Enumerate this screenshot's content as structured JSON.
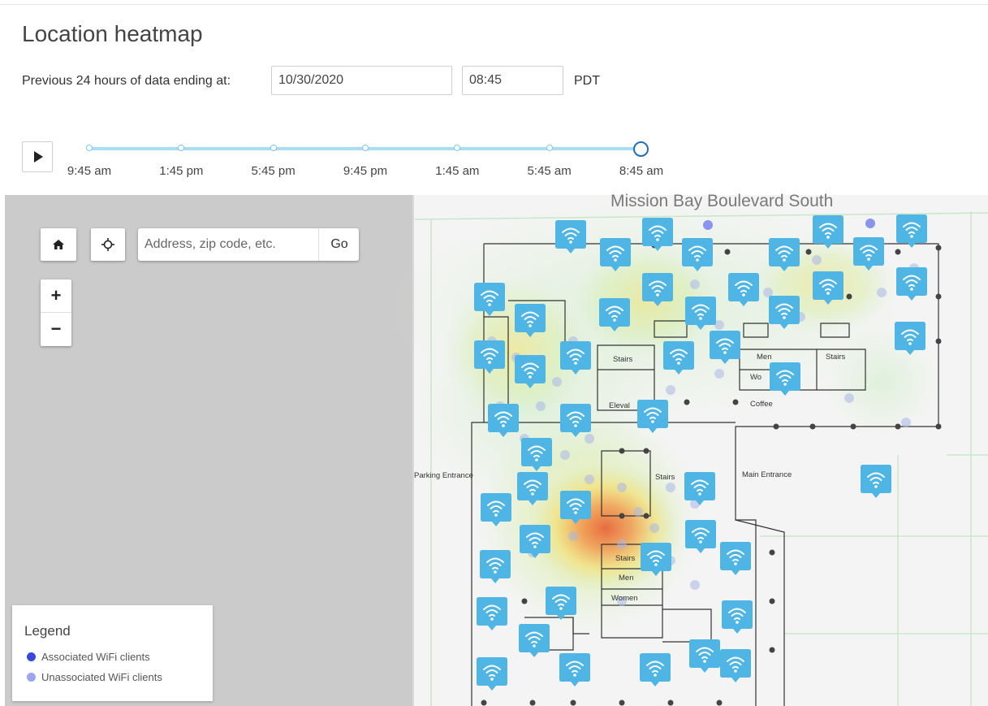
{
  "page": {
    "title": "Location heatmap"
  },
  "filter": {
    "label": "Previous 24 hours of data ending at:",
    "date": "10/30/2020",
    "time": "08:45",
    "timezone": "PDT"
  },
  "timeline": {
    "ticks": [
      "9:45 am",
      "1:45 pm",
      "5:45 pm",
      "9:45 pm",
      "1:45 am",
      "5:45 am",
      "8:45 am"
    ],
    "selected": "8:45 am",
    "play_icon": "play-icon"
  },
  "map": {
    "street": "Mission Bay Boulevard South",
    "search_placeholder": "Address, zip code, etc.",
    "go_label": "Go",
    "home_icon": "home-icon",
    "locate_icon": "crosshair-icon",
    "zoom_in": "+",
    "zoom_out": "−",
    "room_labels": {
      "stairs_1": "Stairs",
      "stairs_2": "Stairs",
      "stairs_3": "Stairs",
      "stairs_4": "Stairs",
      "men_1": "Men",
      "men_2": "Men",
      "women_1": "Wo",
      "women_2": "Women",
      "elevator": "Eleval",
      "coffee": "Coffee",
      "parking": "Parking Entrance",
      "main_entrance": "Main Entrance"
    },
    "access_point_icon": "wifi-icon",
    "access_point_color": "#4fb5e4"
  },
  "legend": {
    "title": "Legend",
    "items": [
      {
        "label": "Associated WiFi clients",
        "color": "#3a46e0"
      },
      {
        "label": "Unassociated WiFi clients",
        "color": "#9aa5f3"
      }
    ]
  }
}
